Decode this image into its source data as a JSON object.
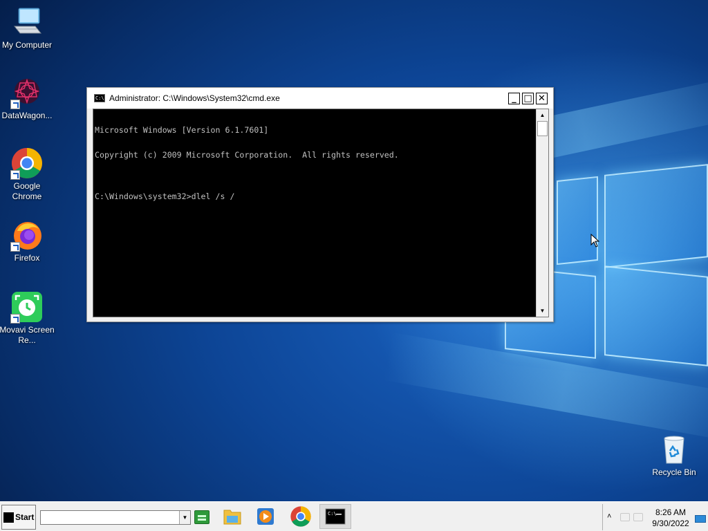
{
  "desktop": {
    "icons": [
      {
        "label": "My Computer",
        "icon": "computer-icon"
      },
      {
        "label": "DataWagon...",
        "icon": "datawagon-icon"
      },
      {
        "label": "Google Chrome",
        "icon": "chrome-icon"
      },
      {
        "label": "Firefox",
        "icon": "firefox-icon"
      },
      {
        "label": "Movavi Screen Re...",
        "icon": "movavi-icon"
      },
      {
        "label": "Recycle Bin",
        "icon": "recycle-bin-icon"
      }
    ]
  },
  "cmd_window": {
    "title": "Administrator: C:\\Windows\\System32\\cmd.exe",
    "icon_text": "C:\\",
    "buttons": {
      "minimize": "_",
      "maximize": "□",
      "close": "✕"
    },
    "lines": [
      "Microsoft Windows [Version 6.1.7601]",
      "Copyright (c) 2009 Microsoft Corporation.  All rights reserved.",
      "",
      "C:\\Windows\\system32>dlel /s /"
    ]
  },
  "taskbar": {
    "start_label": "Start",
    "address_value": "",
    "pinned": [
      "file-explorer-icon",
      "media-player-icon",
      "chrome-icon",
      "cmd-icon"
    ],
    "active": "cmd-icon"
  },
  "tray": {
    "time": "8:26 AM",
    "date": "9/30/2022"
  },
  "colors": {
    "console_bg": "#000000",
    "console_text": "#c0c0c0",
    "taskbar_bg": "#f0f0f0",
    "wallpaper": "#0d4596"
  }
}
